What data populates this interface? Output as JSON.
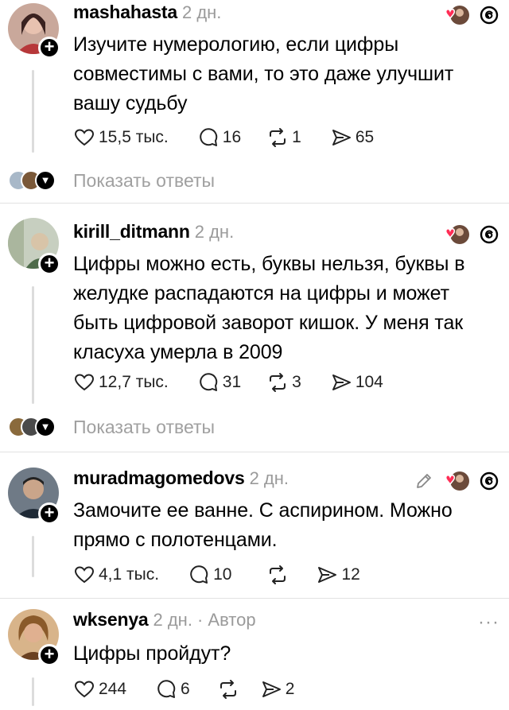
{
  "comments": [
    {
      "username": "mashahasta",
      "time": "2 дн.",
      "text": "Изучите нумерологию, если цифры совместимы с вами, то это даже улучшит вашу судьбу",
      "likes": "15,5 тыс.",
      "replies": "16",
      "reposts": "1",
      "shares": "65",
      "show_replies": "Показать ответы"
    },
    {
      "username": "kirill_ditmann",
      "time": "2 дн.",
      "text": "Цифры можно есть, буквы нельзя, буквы в желудке распадаются на цифры и может быть цифровой заворот кишок. У меня так класуха умерла в 2009",
      "likes": "12,7 тыс.",
      "replies": "31",
      "reposts": "3",
      "shares": "104",
      "show_replies": "Показать ответы"
    },
    {
      "username": "muradmagomedovs",
      "time": "2 дн.",
      "text": "Замочите ее ванне. С аспирином. Можно прямо с полотенцами.",
      "likes": "4,1 тыс.",
      "replies": "10",
      "reposts": "",
      "shares": "12"
    },
    {
      "username": "wksenya",
      "time": "2 дн.",
      "author_tag": "· Автор",
      "text": "Цифры пройдут?",
      "likes": "244",
      "replies": "6",
      "reposts": "",
      "shares": "2"
    }
  ],
  "icons": {
    "like": "heart-outline-icon",
    "reply": "speech-bubble-icon",
    "repost": "repost-arrows-icon",
    "share": "send-icon",
    "threads": "threads-logo-icon",
    "liked_by_author": "heart-with-avatar-icon",
    "edit": "pencil-icon",
    "more": "more-dots-icon",
    "follow": "plus-badge-icon"
  },
  "colors": {
    "liked_heart": "#ff2d55",
    "muted_text": "#9a9a9a",
    "divider": "#e2e2e2"
  }
}
